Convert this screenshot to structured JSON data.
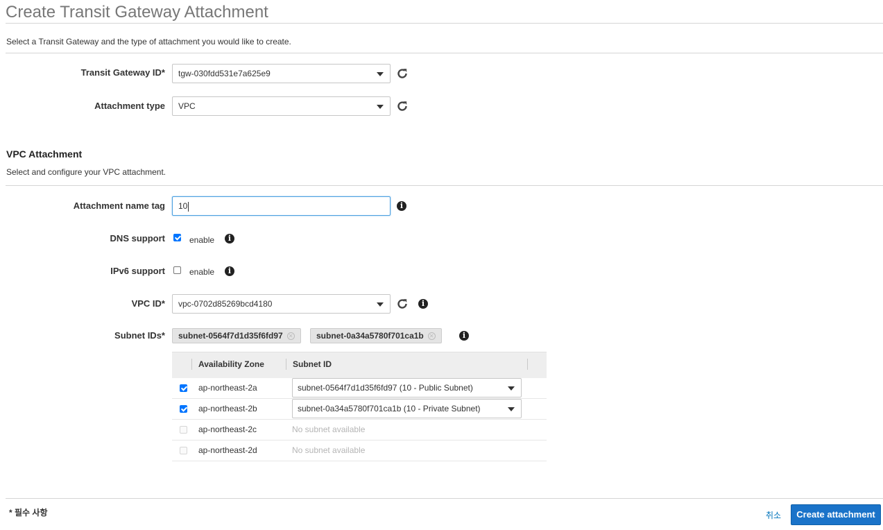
{
  "page": {
    "title": "Create Transit Gateway Attachment",
    "description": "Select a Transit Gateway and the type of attachment you would like to create."
  },
  "gateway_form": {
    "transit_gateway_id": {
      "label": "Transit Gateway ID*",
      "value": "tgw-030fdd531e7a625e9"
    },
    "attachment_type": {
      "label": "Attachment type",
      "value": "VPC"
    }
  },
  "vpc_attachment": {
    "title": "VPC Attachment",
    "description": "Select and configure your VPC attachment.",
    "name_tag": {
      "label": "Attachment name tag",
      "value": "10"
    },
    "dns_support": {
      "label": "DNS support",
      "option": "enable",
      "checked": true
    },
    "ipv6_support": {
      "label": "IPv6 support",
      "option": "enable",
      "checked": false
    },
    "vpc_id": {
      "label": "VPC ID*",
      "value": "vpc-0702d85269bcd4180"
    },
    "subnet_ids": {
      "label": "Subnet IDs*",
      "tokens": [
        "subnet-0564f7d1d35f6fd97",
        "subnet-0a34a5780f701ca1b"
      ]
    },
    "table": {
      "columns": [
        "Availability Zone",
        "Subnet ID"
      ],
      "rows": [
        {
          "zone": "ap-northeast-2a",
          "checked": true,
          "enabled": true,
          "subnet": "subnet-0564f7d1d35f6fd97 (10 - Public Subnet)"
        },
        {
          "zone": "ap-northeast-2b",
          "checked": true,
          "enabled": true,
          "subnet": "subnet-0a34a5780f701ca1b (10 - Private Subnet)"
        },
        {
          "zone": "ap-northeast-2c",
          "checked": false,
          "enabled": false,
          "subnet": "No subnet available"
        },
        {
          "zone": "ap-northeast-2d",
          "checked": false,
          "enabled": false,
          "subnet": "No subnet available"
        }
      ]
    }
  },
  "footer": {
    "required_note": "* 필수 사항",
    "cancel_label": "취소",
    "create_label": "Create attachment"
  },
  "icons": {
    "refresh": "refresh-icon",
    "info": "info-icon",
    "dropdown": "chevron-down-icon",
    "remove": "close-icon"
  },
  "colors": {
    "primary_button": "#1a73c9",
    "link": "#0073bb",
    "focus_border": "#4a9fe0"
  }
}
